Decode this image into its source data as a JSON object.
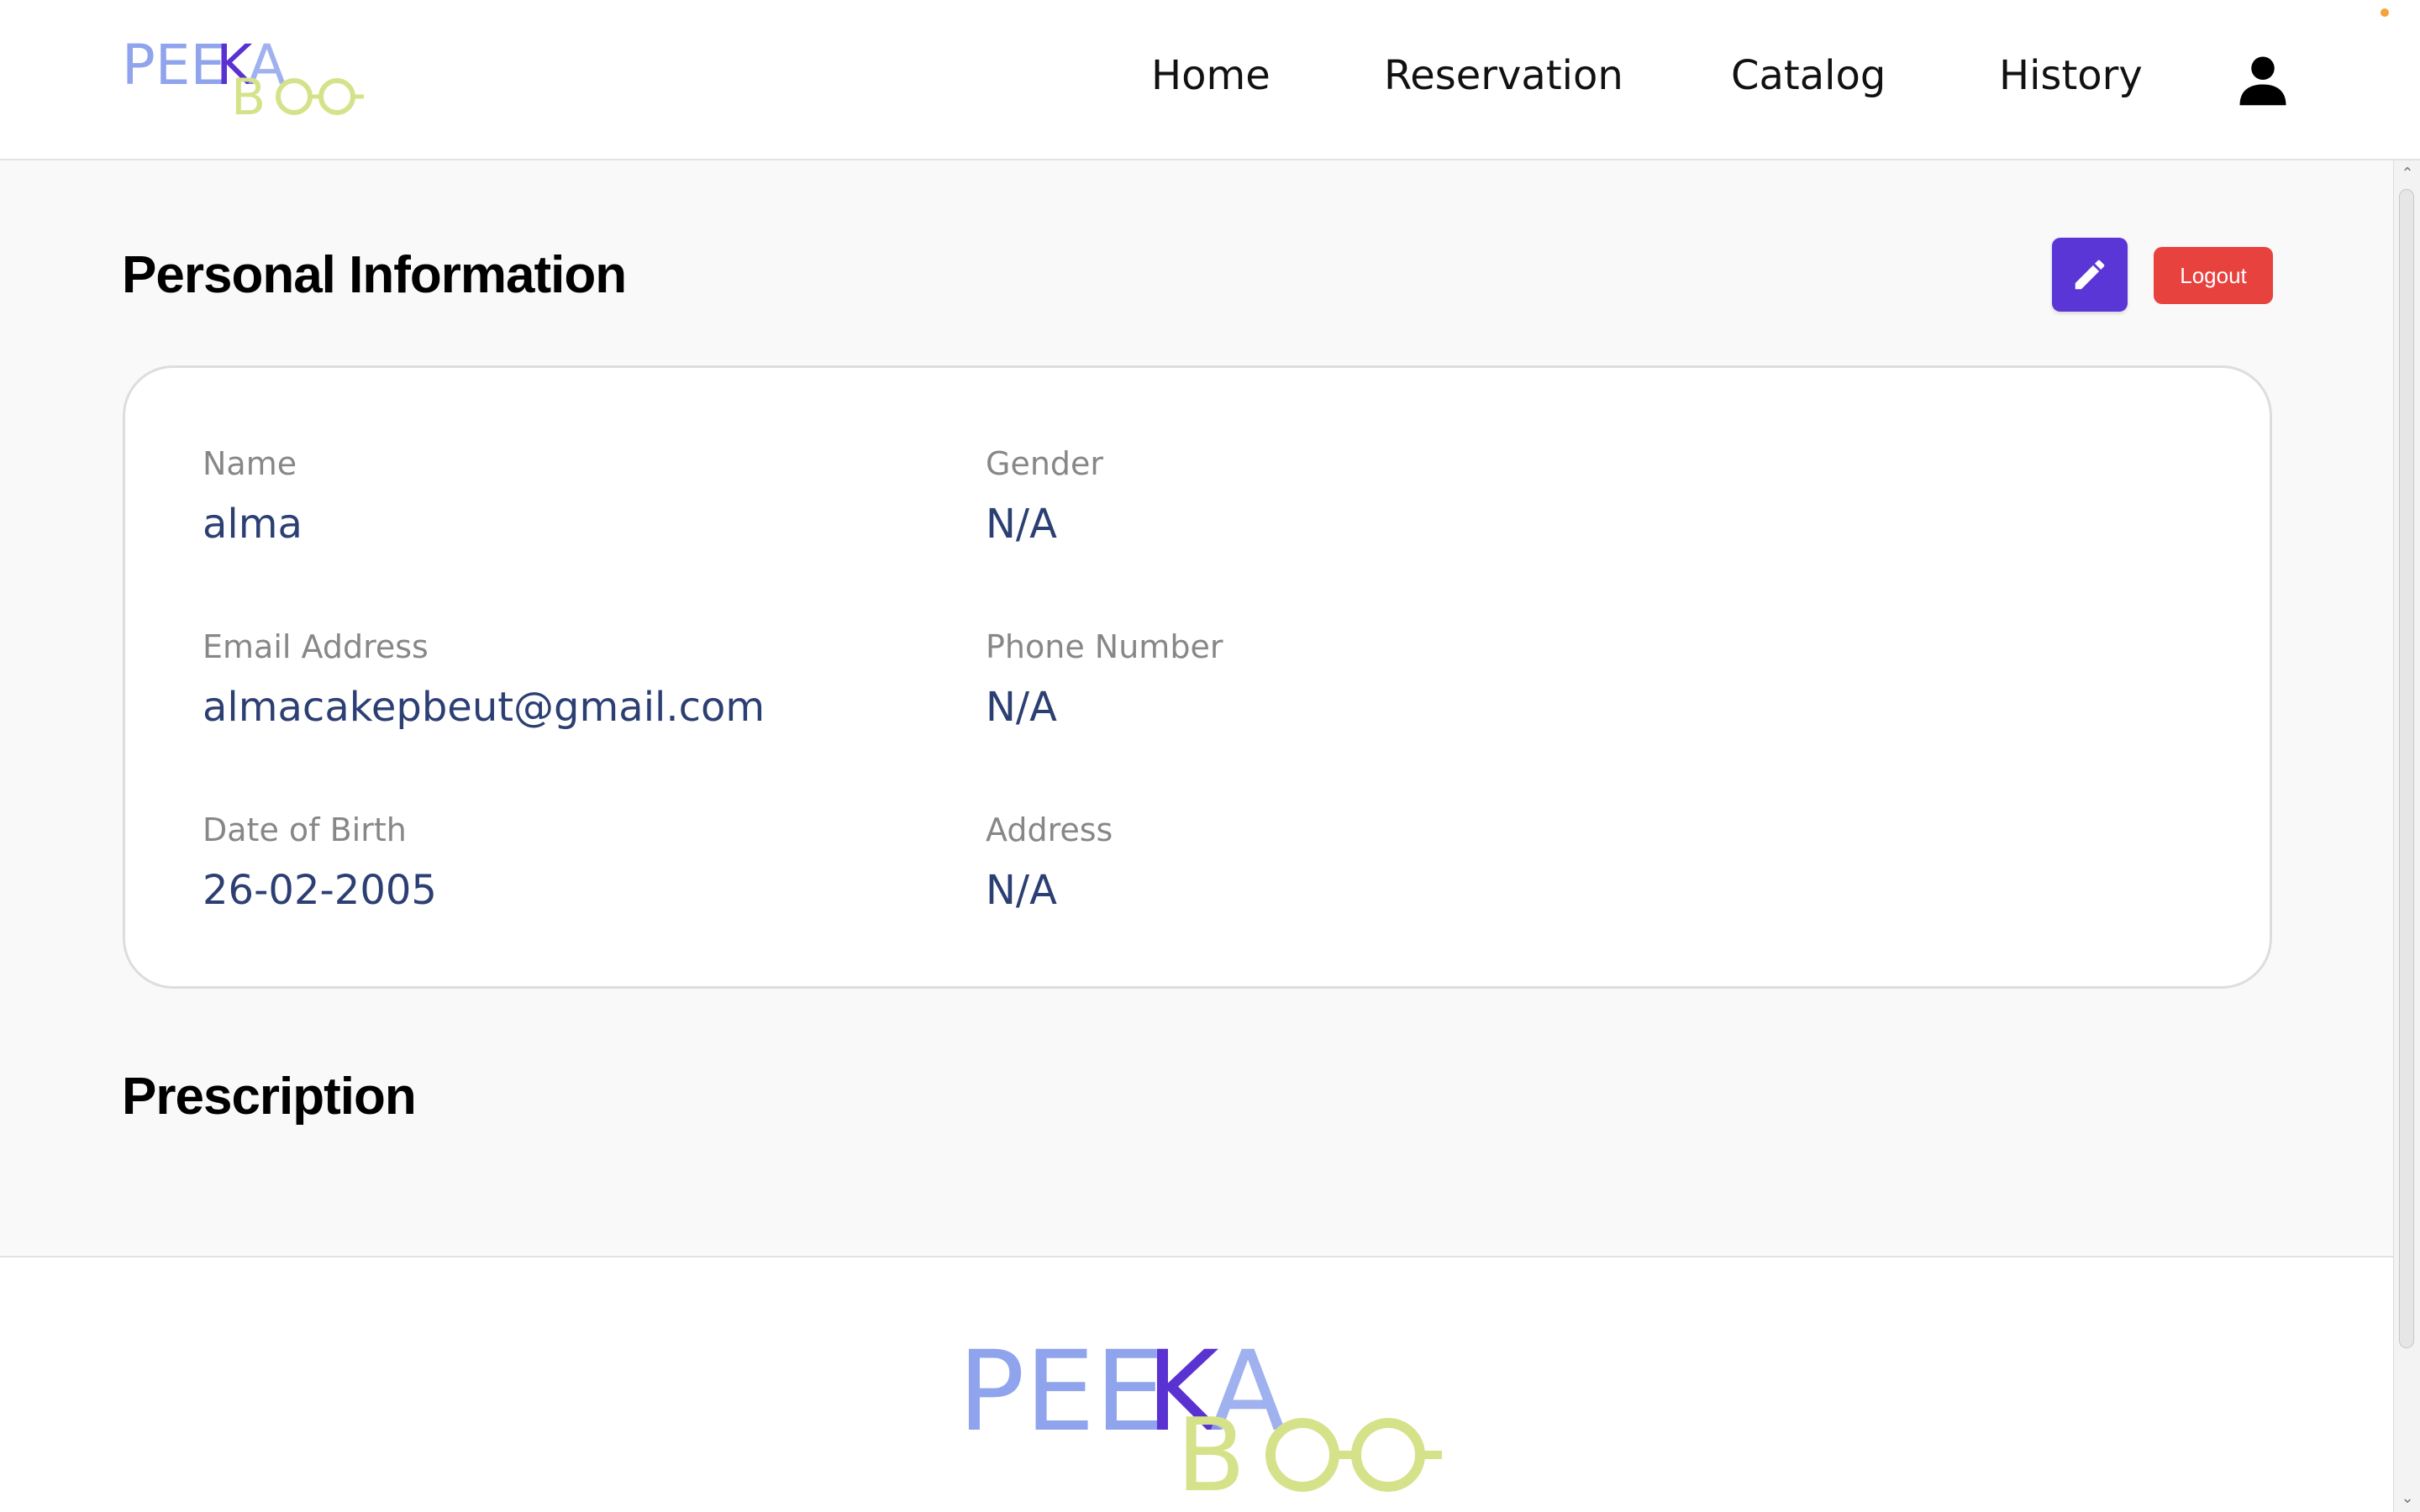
{
  "brand": {
    "name": "PEEKABOO",
    "top": "PEEKA",
    "bottom": "BOO"
  },
  "nav": {
    "items": [
      {
        "label": "Home"
      },
      {
        "label": "Reservation"
      },
      {
        "label": "Catalog"
      },
      {
        "label": "History"
      }
    ],
    "profile_icon": "user-icon"
  },
  "personal_info": {
    "title": "Personal Information",
    "edit_icon": "pencil-icon",
    "logout_label": "Logout",
    "fields": {
      "name": {
        "label": "Name",
        "value": "alma"
      },
      "gender": {
        "label": "Gender",
        "value": "N/A"
      },
      "email": {
        "label": "Email Address",
        "value": "almacakepbeut@gmail.com"
      },
      "phone": {
        "label": "Phone Number",
        "value": "N/A"
      },
      "dob": {
        "label": "Date of Birth",
        "value": "26-02-2005"
      },
      "address": {
        "label": "Address",
        "value": "N/A"
      }
    }
  },
  "prescription": {
    "title": "Prescription"
  },
  "colors": {
    "accent_purple": "#5b36d6",
    "logout_red": "#e8423f",
    "value_text": "#2c3f73",
    "label_text": "#878787",
    "logo_light_blue": "#8fa4ec",
    "logo_purple": "#5a32d2",
    "logo_yellow_green": "#d6e28a"
  }
}
